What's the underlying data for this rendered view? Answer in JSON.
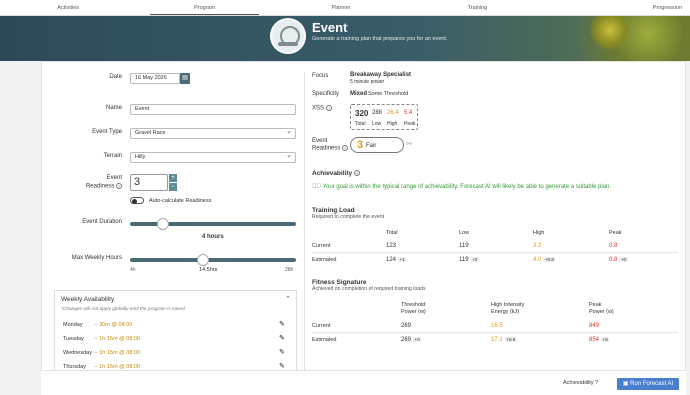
{
  "nav": {
    "tabs": [
      {
        "label": "Activities"
      },
      {
        "label": "Program"
      },
      {
        "label": "Planner"
      },
      {
        "label": "Training"
      },
      {
        "label": "Progression"
      }
    ]
  },
  "banner": {
    "title": "Event",
    "subtitle": "Generate a training plan that prepares you for an event."
  },
  "form": {
    "date_label": "Date",
    "date_value": "16 May 2026",
    "name_label": "Name",
    "name_value": "Event",
    "event_type_label": "Event Type",
    "event_type_value": "Gravel Race",
    "terrain_label": "Terrain",
    "terrain_value": "Hilly",
    "readiness_label_1": "Event",
    "readiness_label_2": "Readiness",
    "readiness_value": "3",
    "stepper_plus": "+",
    "stepper_minus": "−",
    "auto_calc_label": "Auto-calculate Readiness",
    "duration_label": "Event Duration",
    "duration_value": "4 hours",
    "duration_fraction": 0.2,
    "max_weekly_label": "Max Weekly Hours",
    "max_weekly_value": "14.5hrs",
    "max_weekly_min": "4h",
    "max_weekly_max": "28h",
    "max_weekly_fraction": 0.44
  },
  "availability": {
    "title": "Weekly Availability",
    "note": "*Changes will not apply globally until the program is saved.",
    "rows": [
      {
        "day": "Monday",
        "time": "-- 30m @ 08:00"
      },
      {
        "day": "Tuesday",
        "time": "-- 1h 15m @ 08:00"
      },
      {
        "day": "Wednesday",
        "time": "-- 1h 15m @ 08:00"
      },
      {
        "day": "Thursday",
        "time": "-- 1h 15m @ 08:00"
      }
    ]
  },
  "summary": {
    "focus_label": "Focus",
    "focus_value": "Breakaway Specialist",
    "focus_sub": "5 minute power",
    "specificity_label": "Specificity",
    "specificity_value": "Mixed",
    "specificity_sub": "Some Threshold",
    "xss_label": "XSS",
    "xss": {
      "total": "320",
      "low": "288",
      "high": "26.4",
      "peak": "5.4",
      "total_label": "Total",
      "low_label": "Low",
      "high_label": "High",
      "peak_label": "Peak"
    },
    "readiness_label_1": "Event",
    "readiness_label_2": "Readiness",
    "readiness_value": "3",
    "readiness_word": "Fair"
  },
  "achievability": {
    "title": "Achievability",
    "message": "Your goal is within the typical range of achievability. Forecast AI will likely be able to generate a suitable plan."
  },
  "training_load": {
    "title": "Training Load",
    "subtitle": "Required to complete the event",
    "headers": [
      "Total",
      "Low",
      "High",
      "Peak"
    ],
    "current_label": "Current",
    "estimated_label": "Estimated",
    "current": [
      "123",
      "119",
      "3.2",
      "0.8"
    ],
    "estimated": [
      {
        "value": "124",
        "delta": "+1"
      },
      {
        "value": "119",
        "delta": "+0"
      },
      {
        "value": "4.0",
        "delta": "+0.8"
      },
      {
        "value": "0.8",
        "delta": "+0"
      }
    ]
  },
  "fitness_signature": {
    "title": "Fitness Signature",
    "subtitle": "Achieved on completion of required training loads",
    "headers": [
      {
        "l1": "Threshold",
        "l2": "Power (w)"
      },
      {
        "l1": "High Intensity",
        "l2": "Energy (kJ)"
      },
      {
        "l1": "Peak",
        "l2": "Power (w)"
      }
    ],
    "current_label": "Current",
    "estimated_label": "Estimated",
    "current": [
      "269",
      "16.5",
      "849"
    ],
    "estimated": [
      {
        "value": "269",
        "delta": "+0"
      },
      {
        "value": "17.1",
        "delta": "+0.6"
      },
      {
        "value": "854",
        "delta": "+5"
      }
    ]
  },
  "footer": {
    "achievability_label": "Achievability ?",
    "run_button": "Run Forecast AI"
  },
  "colors": {
    "accent": "#4a6b74",
    "button": "#4a7fcf",
    "high": "#e29a14",
    "peak": "#d9372b",
    "success": "#3a9a3a"
  }
}
